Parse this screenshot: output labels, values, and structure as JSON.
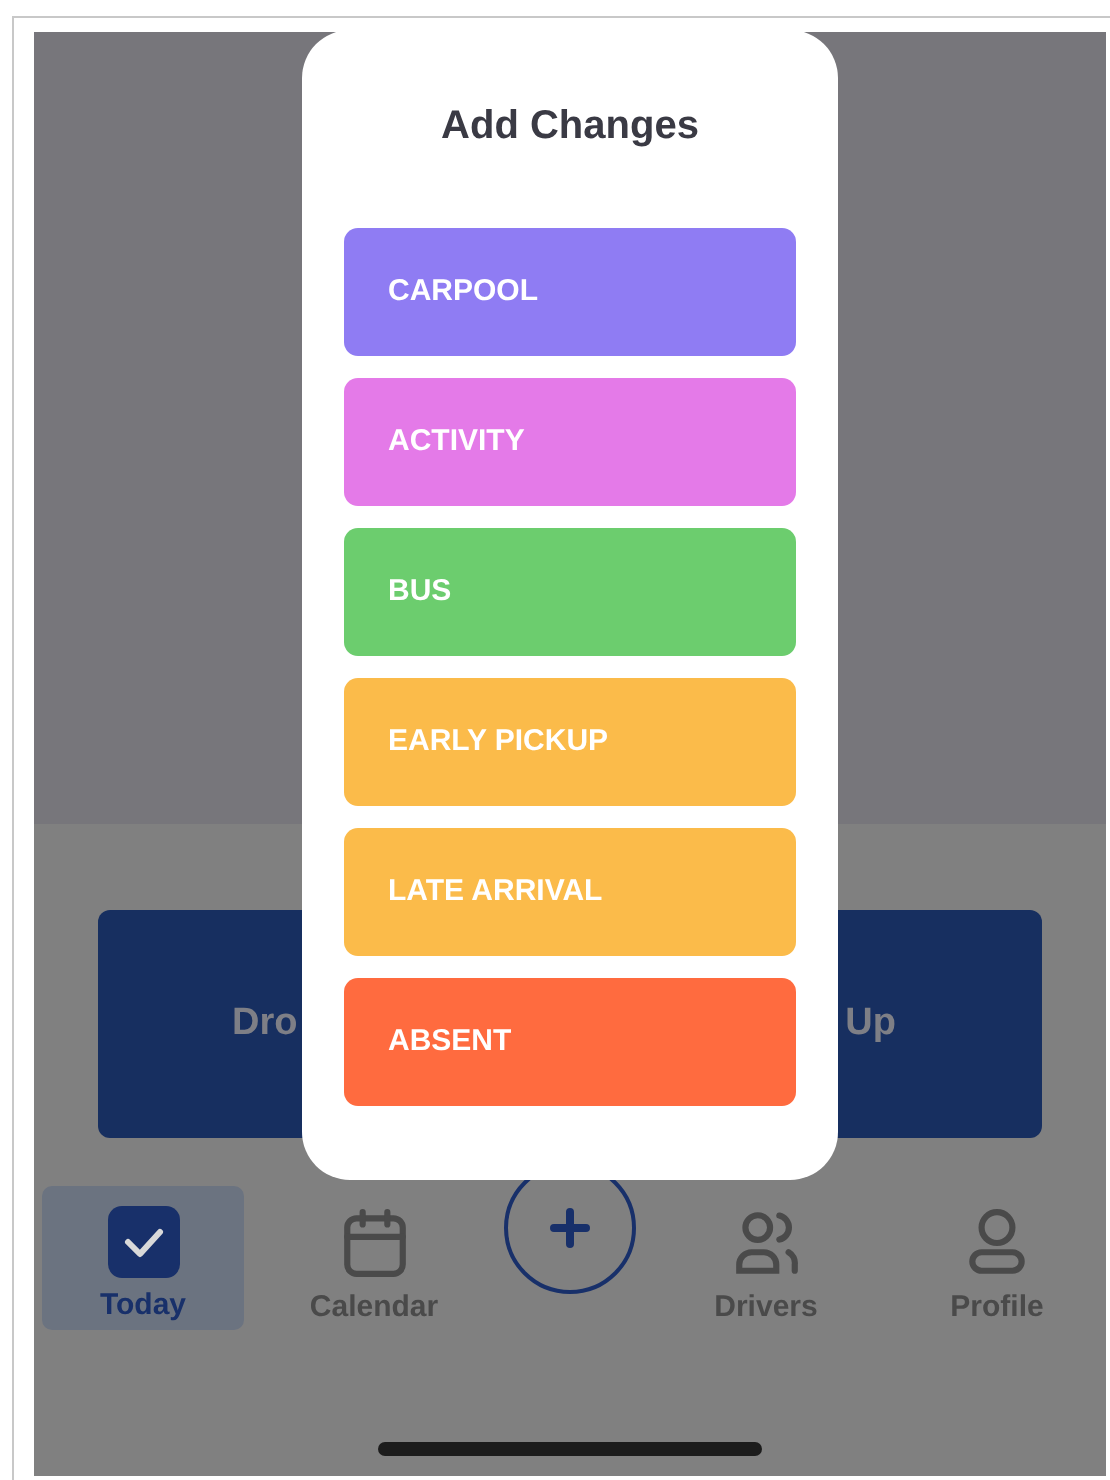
{
  "background_card": {
    "left_text": "Dro",
    "right_text": "Up"
  },
  "modal": {
    "title": "Add Changes",
    "options": [
      {
        "label": "CARPOOL",
        "color": "#8f7cf3"
      },
      {
        "label": "ACTIVITY",
        "color": "#e47ae8"
      },
      {
        "label": "BUS",
        "color": "#6ccd6e"
      },
      {
        "label": "EARLY PICKUP",
        "color": "#fbbb4a"
      },
      {
        "label": "LATE ARRIVAL",
        "color": "#fbbb4a"
      },
      {
        "label": "ABSENT",
        "color": "#ff6b3f"
      }
    ]
  },
  "nav": {
    "items": [
      {
        "kind": "tab",
        "label": "Today",
        "selected": true
      },
      {
        "kind": "tab",
        "label": "Calendar",
        "selected": false
      },
      {
        "kind": "add"
      },
      {
        "kind": "tab",
        "label": "Drivers",
        "selected": false
      },
      {
        "kind": "tab",
        "label": "Profile",
        "selected": false
      }
    ]
  }
}
